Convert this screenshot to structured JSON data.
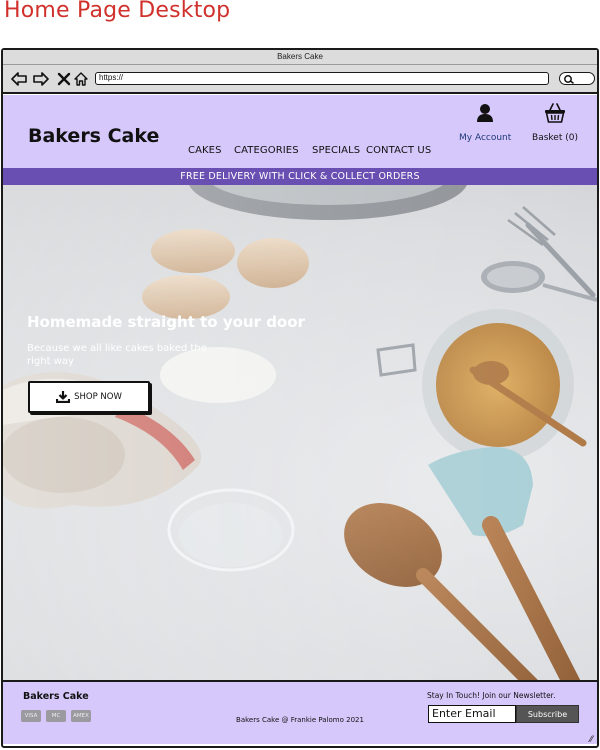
{
  "page_label": "Home Page Desktop",
  "browser": {
    "window_title": "Bakers Cake",
    "url": "https://",
    "icons": [
      "back-icon",
      "forward-icon",
      "stop-icon",
      "home-icon",
      "search-icon"
    ]
  },
  "header": {
    "brand": "Bakers Cake",
    "nav": [
      "CAKES",
      "CATEGORIES",
      "SPECIALS",
      "CONTACT US"
    ],
    "account_label": "My Account",
    "basket_label": "Basket (0)"
  },
  "promo_banner": "FREE DELIVERY WITH CLICK & COLLECT ORDERS",
  "hero": {
    "title": "Homemade straight to your door",
    "subtitle": "Because we all like cakes baked the right way",
    "cta_label": "SHOP NOW"
  },
  "footer": {
    "brand": "Bakers Cake",
    "payment_icons": [
      "VISA",
      "MC",
      "AMEX"
    ],
    "copyright": "Bakers Cake @ Frankie Palomo 2021",
    "newsletter_label": "Stay In Touch! Join our Newsletter.",
    "email_placeholder": "Enter Email",
    "subscribe_label": "Subscribe"
  },
  "colors": {
    "header_bg": "#d7c8fb",
    "banner_bg": "#6a4fb2",
    "account_link": "#1f3a7a",
    "page_label": "#d0312d"
  }
}
